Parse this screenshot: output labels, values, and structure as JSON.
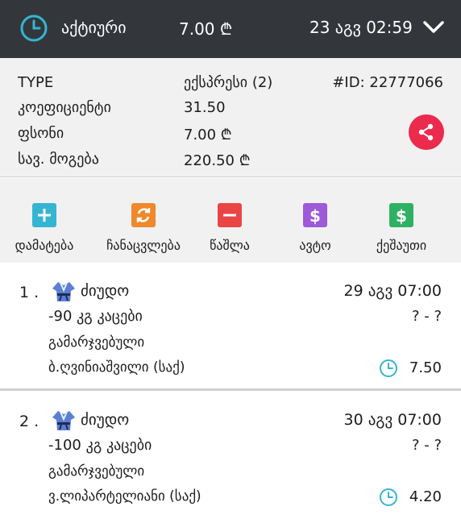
{
  "header": {
    "status": "აქტიური",
    "stake": "7.00 ₾",
    "date": "23 აგვ 02:59"
  },
  "info": {
    "type_label": "TYPE",
    "type_value": "ექსპრესი (2)",
    "bet_id": "#ID: 22777066",
    "coef_label": "კოეფიციენტი",
    "coef_value": "31.50",
    "stake_label": "ფსონი",
    "stake_value": "7.00 ₾",
    "win_label": "სავ. მოგება",
    "win_value": "220.50 ₾"
  },
  "actions": [
    {
      "label": "დამატება",
      "icon": "plus-icon",
      "color": "#35b5d1"
    },
    {
      "label": "ჩანაცვლება",
      "icon": "swap-icon",
      "color": "#f0892c"
    },
    {
      "label": "წაშლა",
      "icon": "minus-icon",
      "color": "#e94545"
    },
    {
      "label": "ავტო",
      "icon": "dollar-icon",
      "color": "#9d59d8"
    },
    {
      "label": "ქეშაუთი",
      "icon": "dollar-icon",
      "color": "#2fb163"
    }
  ],
  "bets": [
    {
      "number": "1 .",
      "sport": "ძიუდო",
      "time": "29 აგვ 07:00",
      "event": "-90 კგ კაცები",
      "score": "? - ?",
      "market": "გამარჯვებული",
      "pick": "ბ.ღვინიაშვილი (საქ)",
      "odd": "7.50"
    },
    {
      "number": "2 .",
      "sport": "ძიუდო",
      "time": "30 აგვ 07:00",
      "event": "-100 კგ კაცები",
      "score": "? - ?",
      "market": "გამარჯვებული",
      "pick": "ვ.ლიპარტელიანი (საქ)",
      "odd": "4.20"
    }
  ],
  "colors": {
    "header_bg": "#33373c",
    "clock_accent": "#35b5d1",
    "share_bg": "#ec2a4d"
  }
}
